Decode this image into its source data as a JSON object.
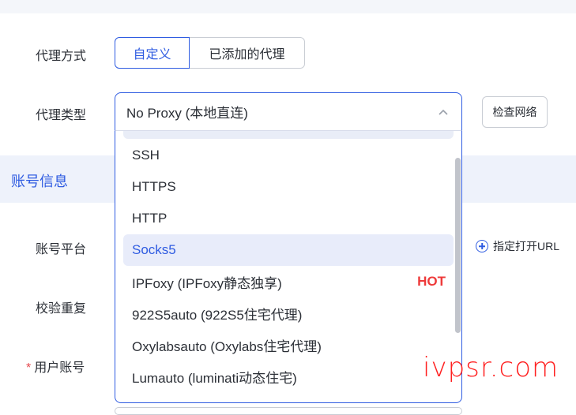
{
  "proxy_mode": {
    "label": "代理方式",
    "options": [
      "自定义",
      "已添加的代理"
    ],
    "selected": "自定义"
  },
  "proxy_type": {
    "label": "代理类型",
    "value": "No Proxy (本地直连)",
    "check_button": "检查网络"
  },
  "section": {
    "title": "账号信息"
  },
  "fields": {
    "platform": "账号平台",
    "dedupe": "校验重复",
    "username_required": "*",
    "username": "用户账号",
    "open_url": "指定打开URL"
  },
  "dropdown": {
    "options": [
      {
        "label": "SSH",
        "badge": ""
      },
      {
        "label": "HTTPS",
        "badge": ""
      },
      {
        "label": "HTTP",
        "badge": ""
      },
      {
        "label": "Socks5",
        "badge": ""
      },
      {
        "label": "IPFoxy (IPFoxy静态独享)",
        "badge": "HOT"
      },
      {
        "label": "922S5auto (922S5住宅代理)",
        "badge": ""
      },
      {
        "label": "Oxylabsauto (Oxylabs住宅代理)",
        "badge": ""
      },
      {
        "label": "Lumauto (luminati动态住宅)",
        "badge": ""
      }
    ],
    "highlighted": "Socks5"
  },
  "watermark": "ivpsr.com",
  "colors": {
    "accent": "#2f5ce1",
    "hot": "#ee3a3a",
    "section_bg": "#eef2fb"
  }
}
